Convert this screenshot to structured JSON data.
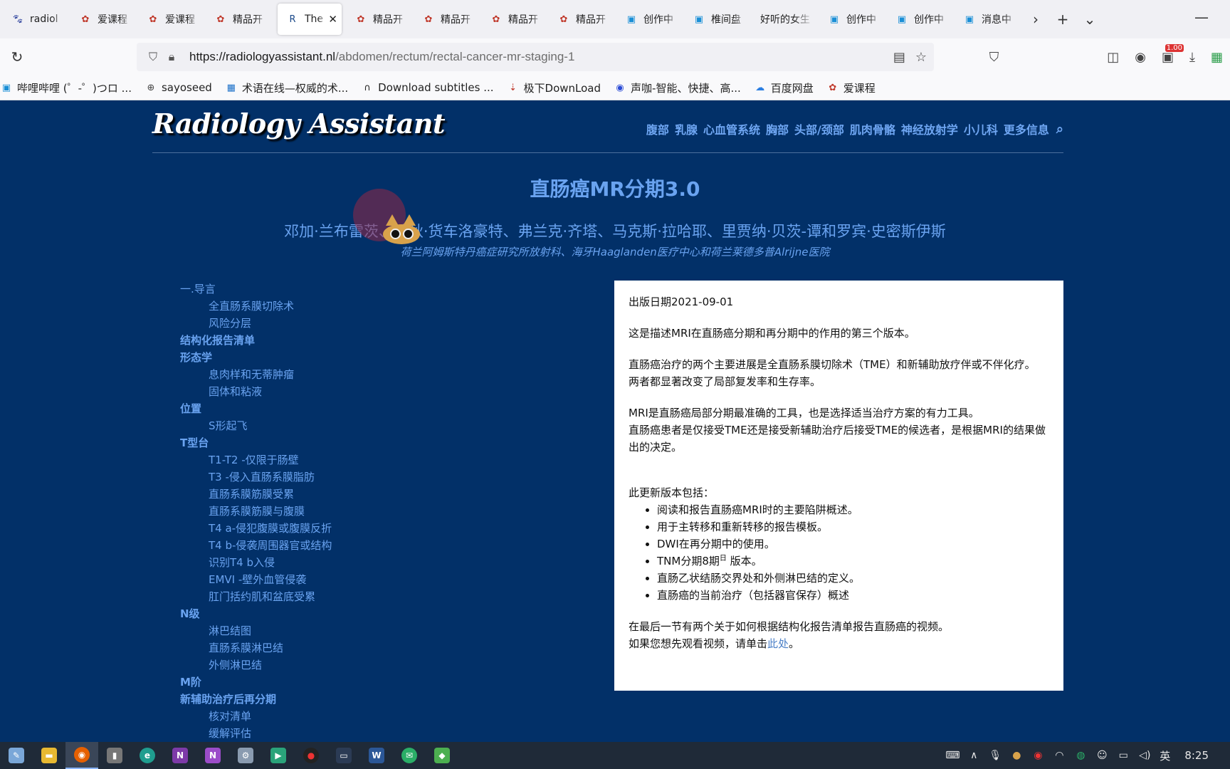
{
  "browser": {
    "tabs": [
      {
        "title": "radiol",
        "icon": "paw-icon",
        "active": false
      },
      {
        "title": "爱课程",
        "icon": "icourse-icon",
        "active": false
      },
      {
        "title": "爱课程",
        "icon": "icourse-icon",
        "active": false
      },
      {
        "title": "精品开",
        "icon": "icourse-icon",
        "active": false
      },
      {
        "title": "The",
        "icon": "radiology-icon",
        "active": true
      },
      {
        "title": "精品开",
        "icon": "icourse-icon",
        "active": false
      },
      {
        "title": "精品开",
        "icon": "icourse-icon",
        "active": false
      },
      {
        "title": "精品开",
        "icon": "icourse-icon",
        "active": false
      },
      {
        "title": "精品开",
        "icon": "icourse-icon",
        "active": false
      },
      {
        "title": "创作中",
        "icon": "bilibili-icon",
        "active": false
      },
      {
        "title": "椎间盘",
        "icon": "bilibili-icon",
        "active": false
      },
      {
        "title": "好听的女生",
        "icon": "",
        "active": false
      },
      {
        "title": "创作中",
        "icon": "bilibili-icon",
        "active": false
      },
      {
        "title": "创作中",
        "icon": "bilibili-icon",
        "active": false
      },
      {
        "title": "消息中",
        "icon": "bilibili-icon",
        "active": false
      }
    ],
    "url_host": "https://radiologyassistant.nl",
    "url_path": "/abdomen/rectum/rectal-cancer-mr-staging-1",
    "download_badge": "1.00",
    "bookmarks": [
      {
        "label": "哔哩哔哩 (゜-゜)つロ ...",
        "icon": "bilibili-icon"
      },
      {
        "label": "sayoseed",
        "icon": "globe-icon"
      },
      {
        "label": "术语在线—权威的术...",
        "icon": "termonline-icon"
      },
      {
        "label": "Download subtitles ...",
        "icon": "subtitle-icon"
      },
      {
        "label": "极下DownLoad",
        "icon": "jixia-icon"
      },
      {
        "label": "声咖-智能、快捷、高...",
        "icon": "shengka-icon"
      },
      {
        "label": "百度网盘",
        "icon": "baidupan-icon"
      },
      {
        "label": "爱课程",
        "icon": "icourse-icon"
      }
    ]
  },
  "site": {
    "logo": "Radiology Assistant",
    "nav": [
      "腹部",
      "乳腺",
      "心血管系统",
      "胸部",
      "头部/颈部",
      "肌肉骨骼",
      "神经放射学",
      "小儿科",
      "更多信息"
    ]
  },
  "article": {
    "title": "直肠癌MR分期3.0",
    "authors": "邓加·兰布雷茨、瑞秋·货车洛豪特、弗兰克·齐塔、马克斯·拉哈耶、里贾纳·贝茨-谭和罗宾·史密斯伊斯",
    "affiliation": "荷兰阿姆斯特丹癌症研究所放射科、海牙Haaglanden医疗中心和荷兰莱德多普Alrijne医院"
  },
  "toc": [
    {
      "label": "一.导言",
      "level": 1,
      "bold": false
    },
    {
      "label": "全直肠系膜切除术",
      "level": 2
    },
    {
      "label": "风险分层",
      "level": 2
    },
    {
      "label": "结构化报告清单",
      "level": 1,
      "bold": true
    },
    {
      "label": "形态学",
      "level": 1,
      "bold": true
    },
    {
      "label": "息肉样和无蒂肿瘤",
      "level": 2
    },
    {
      "label": "固体和粘液",
      "level": 2
    },
    {
      "label": "位置",
      "level": 1,
      "bold": true
    },
    {
      "label": "S形起飞",
      "level": 2
    },
    {
      "label": "T型台",
      "level": 1,
      "bold": true
    },
    {
      "label": "T1-T2 -仅限于肠壁",
      "level": 2
    },
    {
      "label": "T3 -侵入直肠系膜脂肪",
      "level": 2
    },
    {
      "label": "直肠系膜筋膜受累",
      "level": 2
    },
    {
      "label": "直肠系膜筋膜与腹膜",
      "level": 2
    },
    {
      "label": "T4 a-侵犯腹膜或腹膜反折",
      "level": 2
    },
    {
      "label": "T4 b-侵袭周围器官或结构",
      "level": 2
    },
    {
      "label": "识别T4 b入侵",
      "level": 2
    },
    {
      "label": "EMVI -壁外血管侵袭",
      "level": 2
    },
    {
      "label": "肛门括约肌和盆底受累",
      "level": 2
    },
    {
      "label": "N级",
      "level": 1,
      "bold": true
    },
    {
      "label": "淋巴结图",
      "level": 2
    },
    {
      "label": "直肠系膜淋巴结",
      "level": 2
    },
    {
      "label": "外侧淋巴结",
      "level": 2
    },
    {
      "label": "M阶",
      "level": 1,
      "bold": true
    },
    {
      "label": "新辅助治疗后再分期",
      "level": 1,
      "bold": true
    },
    {
      "label": "核对清单",
      "level": 2
    },
    {
      "label": "缓解评估",
      "level": 2
    }
  ],
  "card": {
    "pub_date": "出版日期2021-09-01",
    "p1": "这是描述MRI在直肠癌分期和再分期中的作用的第三个版本。",
    "p2a": "直肠癌治疗的两个主要进展是全直肠系膜切除术（TME）和新辅助放疗伴或不伴化疗。",
    "p2b": "两者都显著改变了局部复发率和生存率。",
    "p3a": "MRI是直肠癌局部分期最准确的工具，也是选择适当治疗方案的有力工具。",
    "p3b": "直肠癌患者是仅接受TME还是接受新辅助治疗后接受TME的候选者，是根据MRI的结果做出的决定。",
    "update_intro": "此更新版本包括：",
    "bullets": [
      "阅读和报告直肠癌MRI时的主要陷阱概述。",
      "用于主转移和重新转移的报告模板。",
      "DWI在再分期中的使用。",
      "TNM分期8期",
      "直肠乙状结肠交界处和外侧淋巴结的定义。",
      "直肠癌的当前治疗（包括器官保存）概述"
    ],
    "bullet4_sup": "日",
    "bullet4_tail": " 版本。",
    "final_a": "在最后一节有两个关于如何根据结构化报告清单报告直肠癌的视频。",
    "final_b_pre": "如果您想先观看视频，请单击",
    "final_link": "此处",
    "final_b_post": "。"
  },
  "taskbar": {
    "ime": "英",
    "clock": "8:25"
  }
}
